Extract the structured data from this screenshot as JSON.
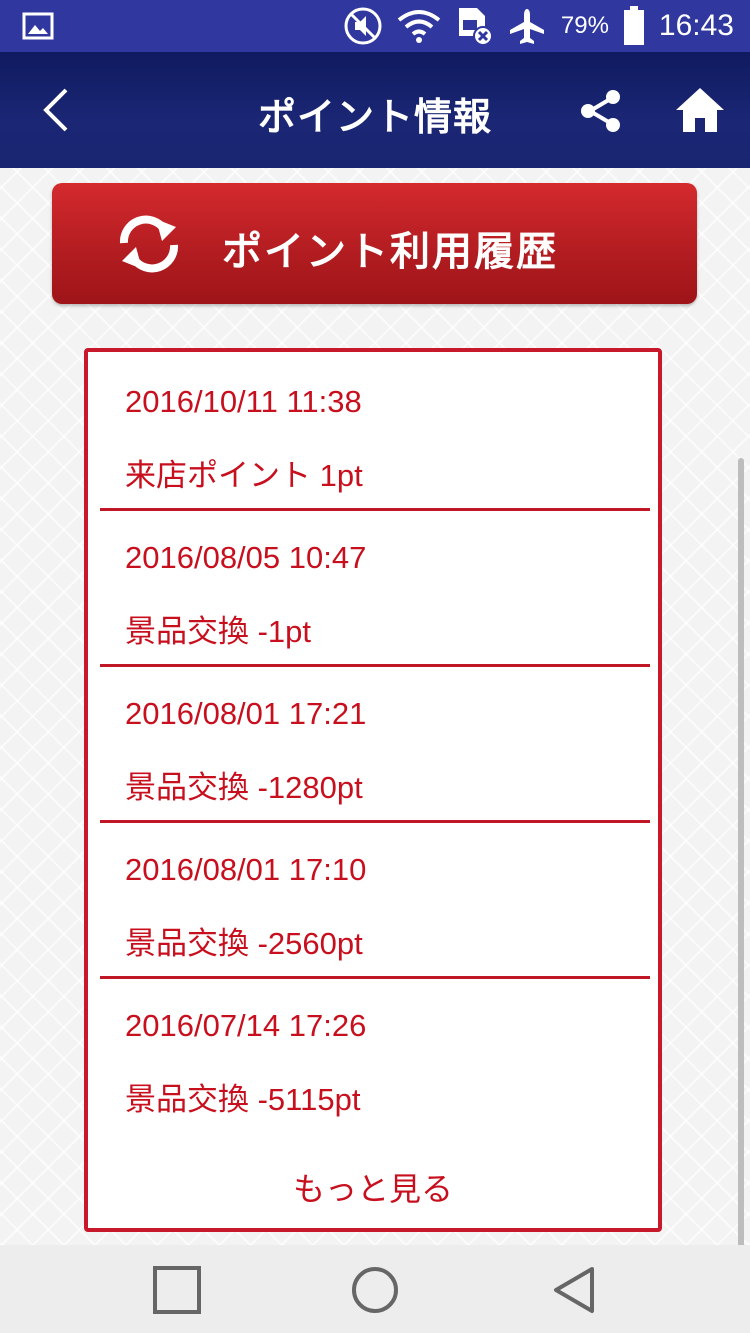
{
  "status_bar": {
    "battery_percent": "79%",
    "time": "16:43",
    "icons": [
      "image-notification-icon",
      "mute-icon",
      "wifi-icon",
      "sim-error-icon",
      "airplane-mode-icon",
      "battery-icon"
    ],
    "background_color": "#3038a0"
  },
  "app_bar": {
    "title": "ポイント情報",
    "icons": [
      "back-arrow-icon",
      "share-icon",
      "home-icon"
    ],
    "background_color": "#1b2775"
  },
  "history_button": {
    "label": "ポイント利用履歴",
    "icon": "refresh-icon",
    "color": "#b11c20"
  },
  "history": {
    "entries": [
      {
        "date": "2016/10/11 11:38",
        "description": "来店ポイント 1pt"
      },
      {
        "date": "2016/08/05 10:47",
        "description": "景品交換 -1pt"
      },
      {
        "date": "2016/08/01 17:21",
        "description": "景品交換 -1280pt"
      },
      {
        "date": "2016/08/01 17:10",
        "description": "景品交換 -2560pt"
      },
      {
        "date": "2016/07/14 17:26",
        "description": "景品交換 -5115pt"
      }
    ],
    "more_label": "もっと見る",
    "accent_color": "#c80f1e"
  },
  "nav_bar": {
    "icons": [
      "recent-apps-icon",
      "home-circle-icon",
      "back-triangle-icon"
    ]
  }
}
